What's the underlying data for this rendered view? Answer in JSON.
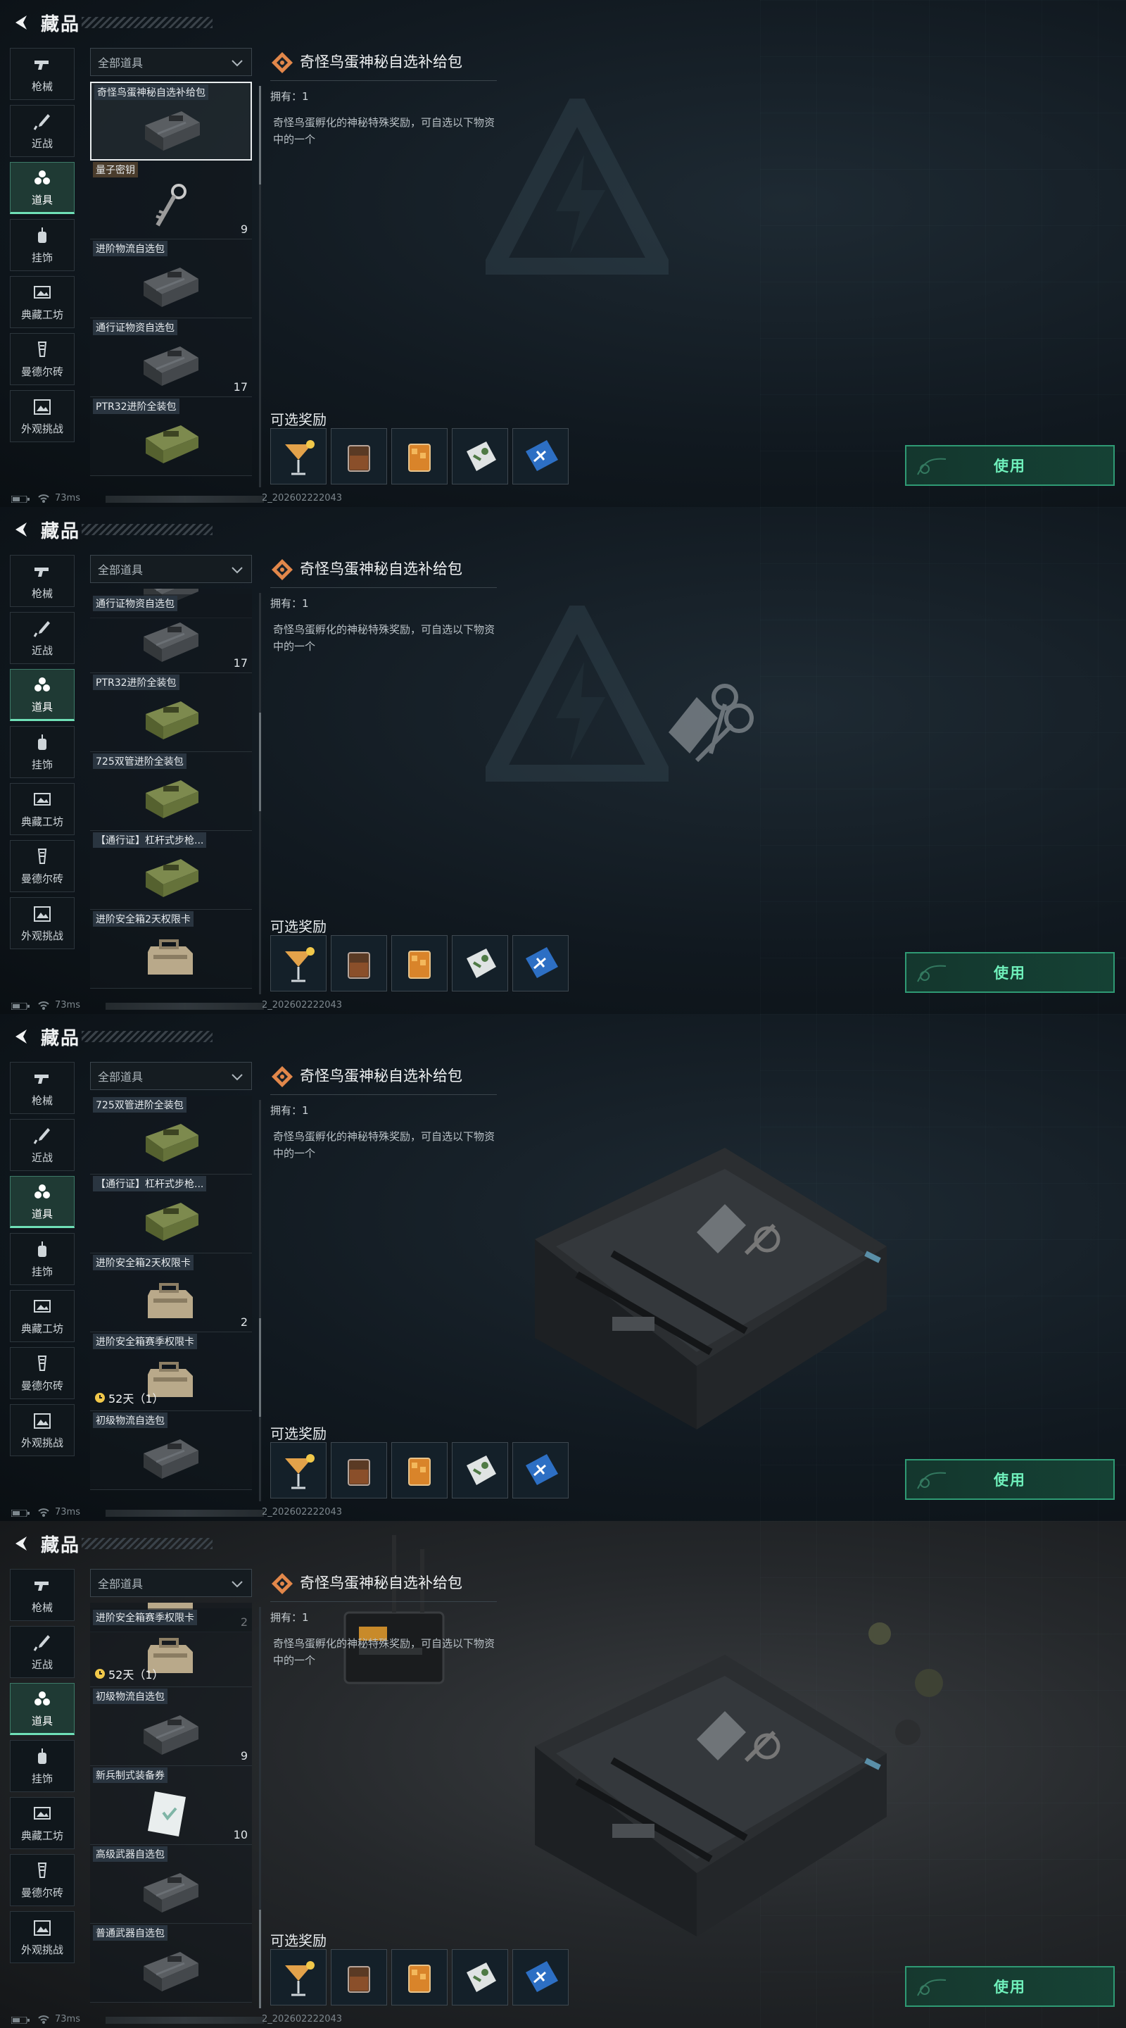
{
  "frames": [
    {
      "header": {
        "title": "藏品"
      },
      "nav": [
        "枪械",
        "近战",
        "道具",
        "挂饰",
        "典藏工坊",
        "曼德尔砖",
        "外观挑战"
      ],
      "filter": "全部道具",
      "items": [
        {
          "label": "奇怪鸟蛋神秘自选补给包",
          "count": "",
          "timer": "",
          "icon": "crate-icon"
        },
        {
          "label": "量子密钥",
          "count": "9",
          "timer": "",
          "icon": "key-icon"
        },
        {
          "label": "进阶物流自选包",
          "count": "",
          "timer": "",
          "icon": "crate-icon"
        },
        {
          "label": "通行证物资自选包",
          "count": "17",
          "timer": "",
          "icon": "crate-icon"
        },
        {
          "label": "PTR32进阶全装包",
          "count": "",
          "timer": "",
          "icon": "green-crate-icon"
        }
      ],
      "detail": {
        "title": "奇怪鸟蛋神秘自选补给包",
        "own": "拥有：1",
        "desc": "奇怪鸟蛋孵化的神秘特殊奖励，可自选以下物资中的一个"
      },
      "rewards_title": "可选奖励",
      "use": "使用",
      "status": {
        "ping": "73ms",
        "build": "2_202602222043"
      }
    },
    {
      "header": {
        "title": "藏品"
      },
      "nav": [
        "枪械",
        "近战",
        "道具",
        "挂饰",
        "典藏工坊",
        "曼德尔砖",
        "外观挑战"
      ],
      "filter": "全部道具",
      "items": [
        {
          "label": "",
          "count": "",
          "timer": "",
          "icon": "crate-icon"
        },
        {
          "label": "通行证物资自选包",
          "count": "17",
          "timer": "",
          "icon": "crate-icon"
        },
        {
          "label": "PTR32进阶全装包",
          "count": "",
          "timer": "",
          "icon": "green-crate-icon"
        },
        {
          "label": "725双管进阶全装包",
          "count": "",
          "timer": "",
          "icon": "green-crate-icon"
        },
        {
          "label": "【通行证】杠杆式步枪...",
          "count": "",
          "timer": "",
          "icon": "green-crate-icon"
        },
        {
          "label": "进阶安全箱2天权限卡",
          "count": "",
          "timer": "",
          "icon": "case-icon"
        }
      ],
      "detail": {
        "title": "奇怪鸟蛋神秘自选补给包",
        "own": "拥有：1",
        "desc": "奇怪鸟蛋孵化的神秘特殊奖励，可自选以下物资中的一个"
      },
      "rewards_title": "可选奖励",
      "use": "使用",
      "status": {
        "ping": "73ms",
        "build": "2_202602222043"
      }
    },
    {
      "header": {
        "title": "藏品"
      },
      "nav": [
        "枪械",
        "近战",
        "道具",
        "挂饰",
        "典藏工坊",
        "曼德尔砖",
        "外观挑战"
      ],
      "filter": "全部道具",
      "items": [
        {
          "label": "725双管进阶全装包",
          "count": "",
          "timer": "",
          "icon": "green-crate-icon"
        },
        {
          "label": "【通行证】杠杆式步枪...",
          "count": "",
          "timer": "",
          "icon": "green-crate-icon"
        },
        {
          "label": "进阶安全箱2天权限卡",
          "count": "2",
          "timer": "",
          "icon": "case-icon"
        },
        {
          "label": "进阶安全箱赛季权限卡",
          "count": "",
          "timer": "52天（1）",
          "icon": "case-icon"
        },
        {
          "label": "初级物流自选包",
          "count": "",
          "timer": "",
          "icon": "crate-icon"
        }
      ],
      "detail": {
        "title": "奇怪鸟蛋神秘自选补给包",
        "own": "拥有：1",
        "desc": "奇怪鸟蛋孵化的神秘特殊奖励，可自选以下物资中的一个"
      },
      "rewards_title": "可选奖励",
      "use": "使用",
      "status": {
        "ping": "73ms",
        "build": "2_202602222043"
      }
    },
    {
      "header": {
        "title": "藏品"
      },
      "nav": [
        "枪械",
        "近战",
        "道具",
        "挂饰",
        "典藏工坊",
        "曼德尔砖",
        "外观挑战"
      ],
      "filter": "全部道具",
      "items": [
        {
          "label": "",
          "count": "2",
          "timer": "",
          "icon": "case-icon"
        },
        {
          "label": "进阶安全箱赛季权限卡",
          "count": "",
          "timer": "52天（1）",
          "icon": "case-icon"
        },
        {
          "label": "初级物流自选包",
          "count": "9",
          "timer": "",
          "icon": "crate-icon"
        },
        {
          "label": "新兵制式装备券",
          "count": "10",
          "timer": "",
          "icon": "ticket-icon"
        },
        {
          "label": "高级武器自选包",
          "count": "",
          "timer": "",
          "icon": "crate-icon"
        },
        {
          "label": "普通武器自选包",
          "count": "",
          "timer": "",
          "icon": "crate-icon"
        }
      ],
      "detail": {
        "title": "奇怪鸟蛋神秘自选补给包",
        "own": "拥有：1",
        "desc": "奇怪鸟蛋孵化的神秘特殊奖励，可自选以下物资中的一个"
      },
      "rewards_title": "可选奖励",
      "use": "使用",
      "status": {
        "ping": "73ms",
        "build": "2_202602222043"
      }
    }
  ]
}
